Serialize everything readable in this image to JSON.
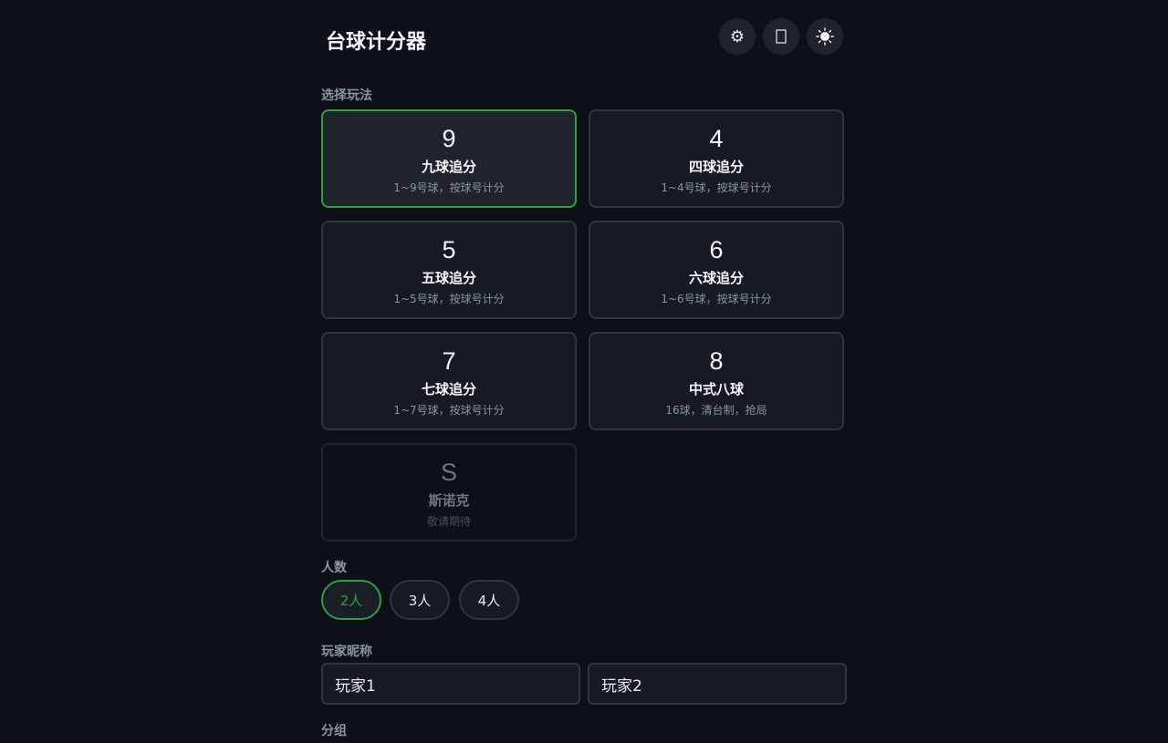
{
  "header": {
    "title": "台球计分器",
    "settings_icon": "gear-icon",
    "fullscreen_icon": "fullscreen-icon",
    "theme_icon": "sun-icon"
  },
  "mode": {
    "label": "选择玩法",
    "cards": [
      {
        "num": "9",
        "name": "九球追分",
        "desc": "1~9号球，按球号计分",
        "state": "selected"
      },
      {
        "num": "4",
        "name": "四球追分",
        "desc": "1~4号球，按球号计分",
        "state": "normal"
      },
      {
        "num": "5",
        "name": "五球追分",
        "desc": "1~5号球，按球号计分",
        "state": "normal"
      },
      {
        "num": "6",
        "name": "六球追分",
        "desc": "1~6号球，按球号计分",
        "state": "normal"
      },
      {
        "num": "7",
        "name": "七球追分",
        "desc": "1~7号球，按球号计分",
        "state": "normal"
      },
      {
        "num": "8",
        "name": "中式八球",
        "desc": "16球，清台制，抢局",
        "state": "normal"
      },
      {
        "num": "S",
        "name": "斯诺克",
        "desc": "敬请期待",
        "state": "disabled"
      }
    ]
  },
  "players_count": {
    "label": "人数",
    "options": [
      "2人",
      "3人",
      "4人"
    ],
    "selected": "2人"
  },
  "nicknames": {
    "label": "玩家昵称",
    "values": [
      "玩家1",
      "玩家2"
    ]
  },
  "next_section_label": "分组",
  "colors": {
    "background": "#0d1117",
    "accent": "#2ea043"
  }
}
